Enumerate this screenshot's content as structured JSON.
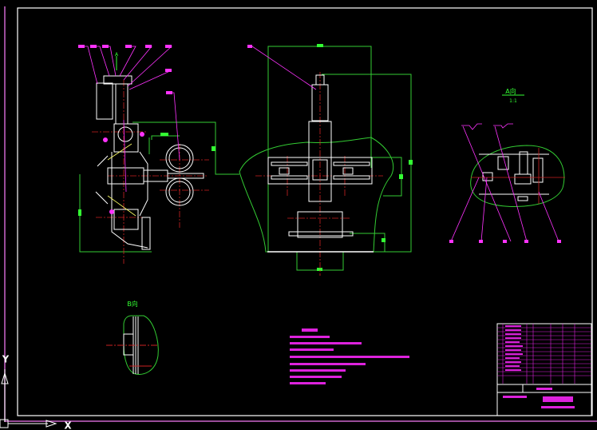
{
  "canvas": {
    "background": "#000000"
  },
  "colors": {
    "outline": "#ffffff",
    "dimension": "#33ff33",
    "leader": "#ff33ff",
    "centerline": "#cc2222",
    "hatch": "#ffff66"
  },
  "views": {
    "main_view_marker": "A",
    "view_a_label": "A向",
    "view_a_scale": "1:1",
    "view_b_label": "B向"
  },
  "ucs": {
    "x_label": "X",
    "y_label": "Y"
  }
}
